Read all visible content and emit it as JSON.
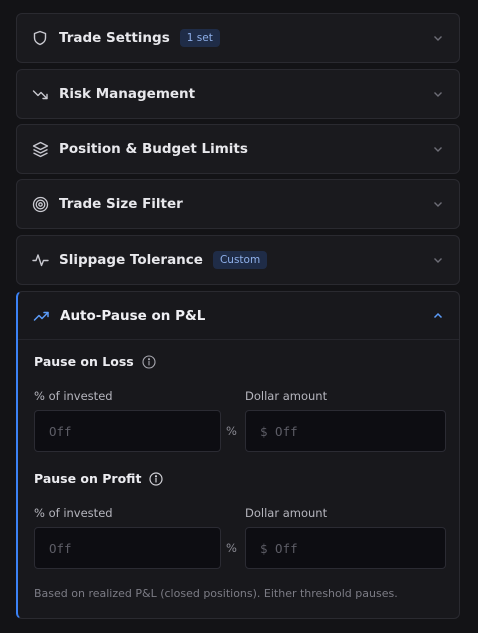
{
  "sections": [
    {
      "label": "Trade Settings",
      "badge": "1 set"
    },
    {
      "label": "Risk Management"
    },
    {
      "label": "Position & Budget Limits"
    },
    {
      "label": "Trade Size Filter"
    },
    {
      "label": "Slippage Tolerance",
      "badge": "Custom"
    }
  ],
  "open_section": {
    "label": "Auto-Pause on P&L",
    "loss": {
      "title": "Pause on Loss",
      "pct_label": "% of invested",
      "pct_placeholder": "Off",
      "pct_suffix": "%",
      "dollar_label": "Dollar amount",
      "dollar_placeholder": "$ Off"
    },
    "profit": {
      "title": "Pause on Profit",
      "pct_label": "% of invested",
      "pct_placeholder": "Off",
      "pct_suffix": "%",
      "dollar_label": "Dollar amount",
      "dollar_placeholder": "$ Off"
    },
    "footnote": "Based on realized P&L (closed positions). Either threshold pauses."
  },
  "colors": {
    "accent": "#3b82f6",
    "badge_bg": "#1f2c47",
    "badge_text": "#8fb0ea"
  }
}
